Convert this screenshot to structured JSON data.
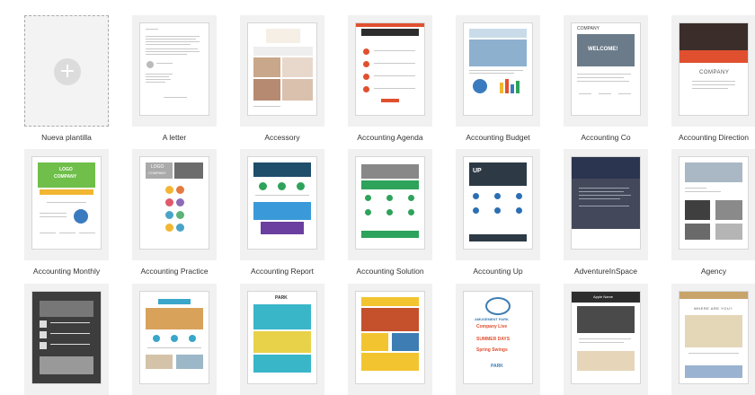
{
  "new_template": {
    "label": "Nueva plantilla",
    "icon": "plus-icon"
  },
  "templates": [
    {
      "label": "A letter"
    },
    {
      "label": "Accessory"
    },
    {
      "label": "Accounting Agenda"
    },
    {
      "label": "Accounting Budget"
    },
    {
      "label": "Accounting Co",
      "thumb_text": [
        "COMPANY",
        "WELCOME!"
      ]
    },
    {
      "label": "Accounting Direction",
      "thumb_text": [
        "COMPANY"
      ]
    },
    {
      "label": "Accounting Monthly",
      "thumb_text": [
        "LOGO",
        "COMPANY"
      ]
    },
    {
      "label": "Accounting Practice",
      "thumb_text": [
        "LOGO",
        "COMPANY"
      ]
    },
    {
      "label": "Accounting Report"
    },
    {
      "label": "Accounting Solution"
    },
    {
      "label": "Accounting Up",
      "thumb_text": [
        "UP"
      ]
    },
    {
      "label": "AdventureInSpace"
    },
    {
      "label": "Agency"
    },
    {
      "label": ""
    },
    {
      "label": ""
    },
    {
      "label": "",
      "thumb_text": [
        "PARK"
      ]
    },
    {
      "label": "",
      "thumb_text": [
        "AMUSEMENT PARK",
        "Company Live",
        "SUMMER DAYS",
        "Spring Swings",
        "PARK"
      ]
    },
    {
      "label": "",
      "thumb_text": [
        "Apple Name"
      ]
    },
    {
      "label": "",
      "thumb_text": [
        "WHERE ARE YOU?"
      ]
    }
  ]
}
